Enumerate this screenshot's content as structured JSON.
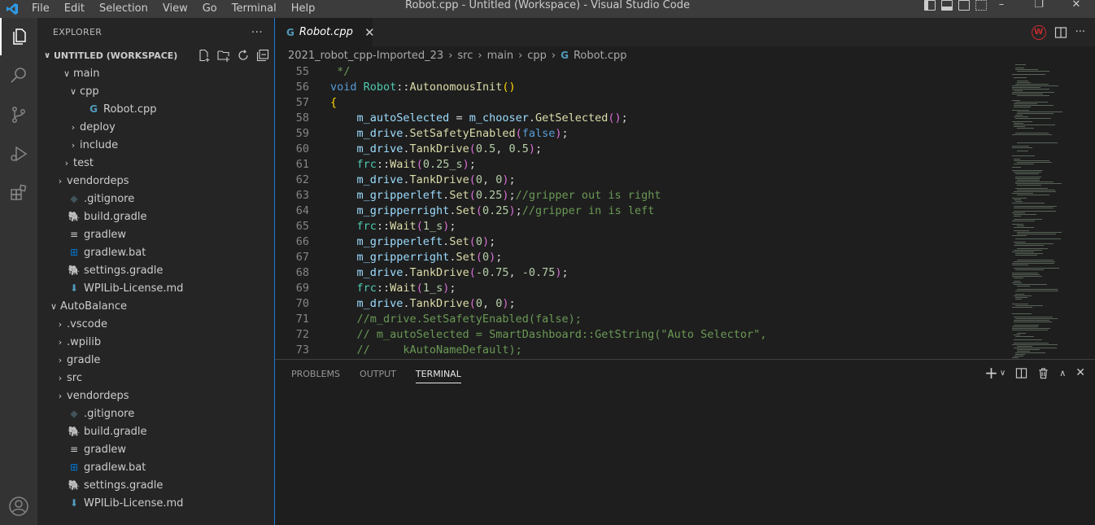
{
  "window": {
    "title": "Robot.cpp - Untitled (Workspace) - Visual Studio Code",
    "menu": [
      "File",
      "Edit",
      "Selection",
      "View",
      "Go",
      "Terminal",
      "Help"
    ]
  },
  "sidebar": {
    "header": "EXPLORER",
    "more": "···",
    "workspace": "UNTITLED (WORKSPACE)",
    "items": [
      {
        "label": "main",
        "chev": "∨",
        "indent": 2,
        "icon": ""
      },
      {
        "label": "cpp",
        "chev": "∨",
        "indent": 3,
        "icon": ""
      },
      {
        "label": "Robot.cpp",
        "chev": "",
        "indent": 4,
        "icon": "cpp"
      },
      {
        "label": "deploy",
        "chev": "›",
        "indent": 3,
        "icon": ""
      },
      {
        "label": "include",
        "chev": "›",
        "indent": 3,
        "icon": ""
      },
      {
        "label": "test",
        "chev": "›",
        "indent": 2,
        "icon": ""
      },
      {
        "label": "vendordeps",
        "chev": "›",
        "indent": 1,
        "icon": ""
      },
      {
        "label": ".gitignore",
        "chev": "",
        "indent": 1,
        "icon": "git"
      },
      {
        "label": "build.gradle",
        "chev": "",
        "indent": 1,
        "icon": "gradle"
      },
      {
        "label": "gradlew",
        "chev": "",
        "indent": 1,
        "icon": "lines"
      },
      {
        "label": "gradlew.bat",
        "chev": "",
        "indent": 1,
        "icon": "windows"
      },
      {
        "label": "settings.gradle",
        "chev": "",
        "indent": 1,
        "icon": "gradle"
      },
      {
        "label": "WPILib-License.md",
        "chev": "",
        "indent": 1,
        "icon": "download"
      },
      {
        "label": "AutoBalance",
        "chev": "∨",
        "indent": 0,
        "icon": ""
      },
      {
        "label": ".vscode",
        "chev": "›",
        "indent": 1,
        "icon": ""
      },
      {
        "label": ".wpilib",
        "chev": "›",
        "indent": 1,
        "icon": ""
      },
      {
        "label": "gradle",
        "chev": "›",
        "indent": 1,
        "icon": ""
      },
      {
        "label": "src",
        "chev": "›",
        "indent": 1,
        "icon": ""
      },
      {
        "label": "vendordeps",
        "chev": "›",
        "indent": 1,
        "icon": ""
      },
      {
        "label": ".gitignore",
        "chev": "",
        "indent": 1,
        "icon": "git"
      },
      {
        "label": "build.gradle",
        "chev": "",
        "indent": 1,
        "icon": "gradle"
      },
      {
        "label": "gradlew",
        "chev": "",
        "indent": 1,
        "icon": "lines"
      },
      {
        "label": "gradlew.bat",
        "chev": "",
        "indent": 1,
        "icon": "windows"
      },
      {
        "label": "settings.gradle",
        "chev": "",
        "indent": 1,
        "icon": "gradle"
      },
      {
        "label": "WPILib-License.md",
        "chev": "",
        "indent": 1,
        "icon": "download"
      }
    ]
  },
  "tab": {
    "label": "Robot.cpp",
    "close": "✕",
    "icon": "G"
  },
  "breadcrumb": [
    "2021_robot_cpp-Imported_23",
    "src",
    "main",
    "cpp",
    "Robot.cpp"
  ],
  "code": [
    {
      "n": "55",
      "tokens": [
        [
          " */",
          "#6a9955"
        ]
      ]
    },
    {
      "n": "56",
      "tokens": [
        [
          "void ",
          "#569cd6"
        ],
        [
          "Robot",
          "#4ec9b0"
        ],
        [
          "::",
          "#d4d4d4"
        ],
        [
          "AutonomousInit",
          "#dcdcaa"
        ],
        [
          "()",
          "#ffd700"
        ]
      ]
    },
    {
      "n": "57",
      "tokens": [
        [
          "{",
          "#ffd700"
        ]
      ]
    },
    {
      "n": "58",
      "tokens": [
        [
          "    m_autoSelected",
          "#9cdcfe"
        ],
        [
          " = ",
          "#d4d4d4"
        ],
        [
          "m_chooser",
          "#9cdcfe"
        ],
        [
          ".",
          "#d4d4d4"
        ],
        [
          "GetSelected",
          "#dcdcaa"
        ],
        [
          "()",
          "#da70d6"
        ],
        [
          ";",
          "#d4d4d4"
        ]
      ]
    },
    {
      "n": "59",
      "tokens": [
        [
          "    m_drive",
          "#9cdcfe"
        ],
        [
          ".",
          "#d4d4d4"
        ],
        [
          "SetSafetyEnabled",
          "#dcdcaa"
        ],
        [
          "(",
          "#da70d6"
        ],
        [
          "false",
          "#569cd6"
        ],
        [
          ")",
          "#da70d6"
        ],
        [
          ";",
          "#d4d4d4"
        ]
      ]
    },
    {
      "n": "60",
      "tokens": [
        [
          "    m_drive",
          "#9cdcfe"
        ],
        [
          ".",
          "#d4d4d4"
        ],
        [
          "TankDrive",
          "#dcdcaa"
        ],
        [
          "(",
          "#da70d6"
        ],
        [
          "0.5",
          "#b5cea8"
        ],
        [
          ", ",
          "#d4d4d4"
        ],
        [
          "0.5",
          "#b5cea8"
        ],
        [
          ")",
          "#da70d6"
        ],
        [
          ";",
          "#d4d4d4"
        ]
      ]
    },
    {
      "n": "61",
      "tokens": [
        [
          "    frc",
          "#4ec9b0"
        ],
        [
          "::",
          "#d4d4d4"
        ],
        [
          "Wait",
          "#dcdcaa"
        ],
        [
          "(",
          "#da70d6"
        ],
        [
          "0.25_s",
          "#b5cea8"
        ],
        [
          ")",
          "#da70d6"
        ],
        [
          ";",
          "#d4d4d4"
        ]
      ]
    },
    {
      "n": "62",
      "tokens": [
        [
          "    m_drive",
          "#9cdcfe"
        ],
        [
          ".",
          "#d4d4d4"
        ],
        [
          "TankDrive",
          "#dcdcaa"
        ],
        [
          "(",
          "#da70d6"
        ],
        [
          "0",
          "#b5cea8"
        ],
        [
          ", ",
          "#d4d4d4"
        ],
        [
          "0",
          "#b5cea8"
        ],
        [
          ")",
          "#da70d6"
        ],
        [
          ";",
          "#d4d4d4"
        ]
      ]
    },
    {
      "n": "63",
      "tokens": [
        [
          "    m_gripperleft",
          "#9cdcfe"
        ],
        [
          ".",
          "#d4d4d4"
        ],
        [
          "Set",
          "#dcdcaa"
        ],
        [
          "(",
          "#da70d6"
        ],
        [
          "0.25",
          "#b5cea8"
        ],
        [
          ")",
          "#da70d6"
        ],
        [
          ";",
          "#d4d4d4"
        ],
        [
          "//gripper out is right",
          "#6a9955"
        ]
      ]
    },
    {
      "n": "64",
      "tokens": [
        [
          "    m_gripperright",
          "#9cdcfe"
        ],
        [
          ".",
          "#d4d4d4"
        ],
        [
          "Set",
          "#dcdcaa"
        ],
        [
          "(",
          "#da70d6"
        ],
        [
          "0.25",
          "#b5cea8"
        ],
        [
          ")",
          "#da70d6"
        ],
        [
          ";",
          "#d4d4d4"
        ],
        [
          "//gripper in is left",
          "#6a9955"
        ]
      ]
    },
    {
      "n": "65",
      "tokens": [
        [
          "    frc",
          "#4ec9b0"
        ],
        [
          "::",
          "#d4d4d4"
        ],
        [
          "Wait",
          "#dcdcaa"
        ],
        [
          "(",
          "#da70d6"
        ],
        [
          "1_s",
          "#b5cea8"
        ],
        [
          ")",
          "#da70d6"
        ],
        [
          ";",
          "#d4d4d4"
        ]
      ]
    },
    {
      "n": "66",
      "tokens": [
        [
          "    m_gripperleft",
          "#9cdcfe"
        ],
        [
          ".",
          "#d4d4d4"
        ],
        [
          "Set",
          "#dcdcaa"
        ],
        [
          "(",
          "#da70d6"
        ],
        [
          "0",
          "#b5cea8"
        ],
        [
          ")",
          "#da70d6"
        ],
        [
          ";",
          "#d4d4d4"
        ]
      ]
    },
    {
      "n": "67",
      "tokens": [
        [
          "    m_gripperright",
          "#9cdcfe"
        ],
        [
          ".",
          "#d4d4d4"
        ],
        [
          "Set",
          "#dcdcaa"
        ],
        [
          "(",
          "#da70d6"
        ],
        [
          "0",
          "#b5cea8"
        ],
        [
          ")",
          "#da70d6"
        ],
        [
          ";",
          "#d4d4d4"
        ]
      ]
    },
    {
      "n": "68",
      "tokens": [
        [
          "    m_drive",
          "#9cdcfe"
        ],
        [
          ".",
          "#d4d4d4"
        ],
        [
          "TankDrive",
          "#dcdcaa"
        ],
        [
          "(",
          "#da70d6"
        ],
        [
          "-0.75",
          "#b5cea8"
        ],
        [
          ", ",
          "#d4d4d4"
        ],
        [
          "-0.75",
          "#b5cea8"
        ],
        [
          ")",
          "#da70d6"
        ],
        [
          ";",
          "#d4d4d4"
        ]
      ]
    },
    {
      "n": "69",
      "tokens": [
        [
          "    frc",
          "#4ec9b0"
        ],
        [
          "::",
          "#d4d4d4"
        ],
        [
          "Wait",
          "#dcdcaa"
        ],
        [
          "(",
          "#da70d6"
        ],
        [
          "1_s",
          "#b5cea8"
        ],
        [
          ")",
          "#da70d6"
        ],
        [
          ";",
          "#d4d4d4"
        ]
      ]
    },
    {
      "n": "70",
      "tokens": [
        [
          "    m_drive",
          "#9cdcfe"
        ],
        [
          ".",
          "#d4d4d4"
        ],
        [
          "TankDrive",
          "#dcdcaa"
        ],
        [
          "(",
          "#da70d6"
        ],
        [
          "0",
          "#b5cea8"
        ],
        [
          ", ",
          "#d4d4d4"
        ],
        [
          "0",
          "#b5cea8"
        ],
        [
          ")",
          "#da70d6"
        ],
        [
          ";",
          "#d4d4d4"
        ]
      ]
    },
    {
      "n": "71",
      "tokens": [
        [
          "    //m_drive.SetSafetyEnabled(false);",
          "#6a9955"
        ]
      ]
    },
    {
      "n": "72",
      "tokens": [
        [
          "    // m_autoSelected = SmartDashboard::GetString(\"Auto Selector\",",
          "#6a9955"
        ]
      ]
    },
    {
      "n": "73",
      "tokens": [
        [
          "    //     kAutoNameDefault);",
          "#6a9955"
        ]
      ]
    }
  ],
  "panel": {
    "tabs": [
      "PROBLEMS",
      "OUTPUT",
      "TERMINAL"
    ],
    "active": "TERMINAL"
  }
}
